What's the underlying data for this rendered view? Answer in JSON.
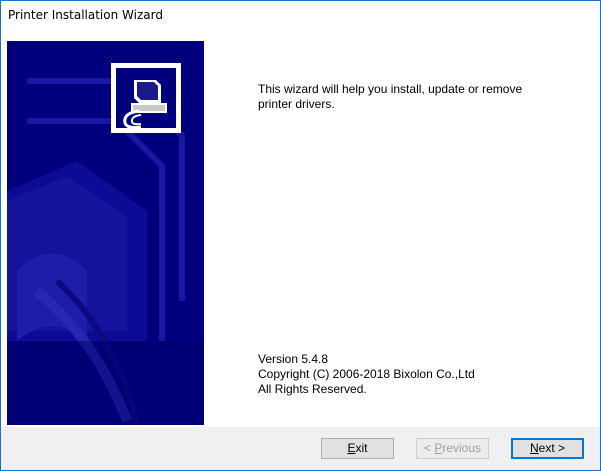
{
  "window": {
    "title": "Printer Installation Wizard"
  },
  "intro": {
    "line1": "This wizard will help you install, update or remove",
    "line2": "printer drivers."
  },
  "info": {
    "version": "Version 5.4.8",
    "copyright": "Copyright (C) 2006-2018 Bixolon Co.,Ltd",
    "rights": "All Rights Reserved."
  },
  "buttons": {
    "exit": {
      "pre": "",
      "mnemonic": "E",
      "post": "xit"
    },
    "previous": {
      "pre": "< ",
      "mnemonic": "P",
      "post": "revious"
    },
    "next": {
      "pre": "",
      "mnemonic": "N",
      "post": "ext >"
    }
  },
  "icons": {
    "printer": "printer-install-icon"
  },
  "colors": {
    "panel_blue": "#00007e",
    "panel_dark": "#000050",
    "default_button_border": "#0078d7",
    "window_border": "#1a6fc9"
  }
}
